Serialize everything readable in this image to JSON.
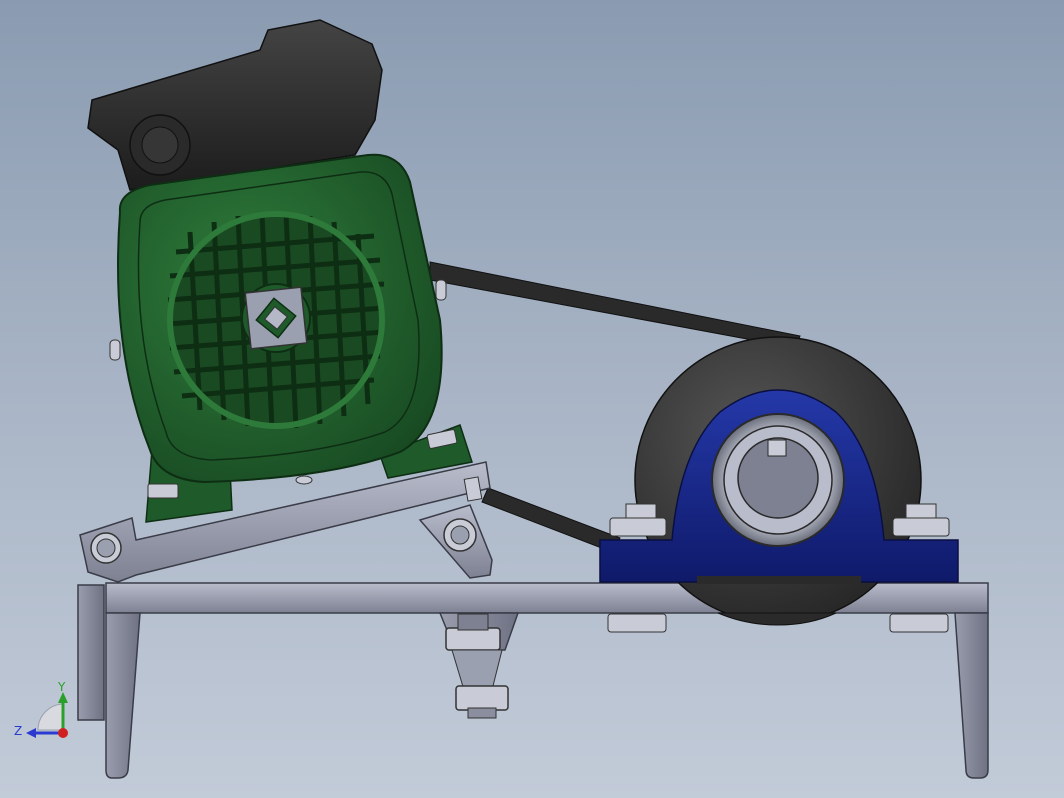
{
  "viewport": {
    "background_top": "#8a9bb1",
    "background_bottom": "#c2cbd8"
  },
  "colors": {
    "motor_green": "#1f5a2a",
    "motor_green_light": "#2e7a3a",
    "motor_cover_dark": "#2e2e2e",
    "frame_gray": "#8a8e9e",
    "frame_gray_light": "#b5b8c6",
    "bearing_blue": "#1a2a8a",
    "pulley_dark": "#3a3a3a",
    "belt_dark": "#2a2a2a"
  },
  "triad": {
    "y_label": "Y",
    "z_label": "Z",
    "y_color": "#2aa02a",
    "z_color": "#2a3ad0",
    "origin_color": "#d02020",
    "icons": [
      "triad-y-arrow-icon",
      "triad-z-arrow-icon",
      "triad-origin-icon"
    ]
  }
}
